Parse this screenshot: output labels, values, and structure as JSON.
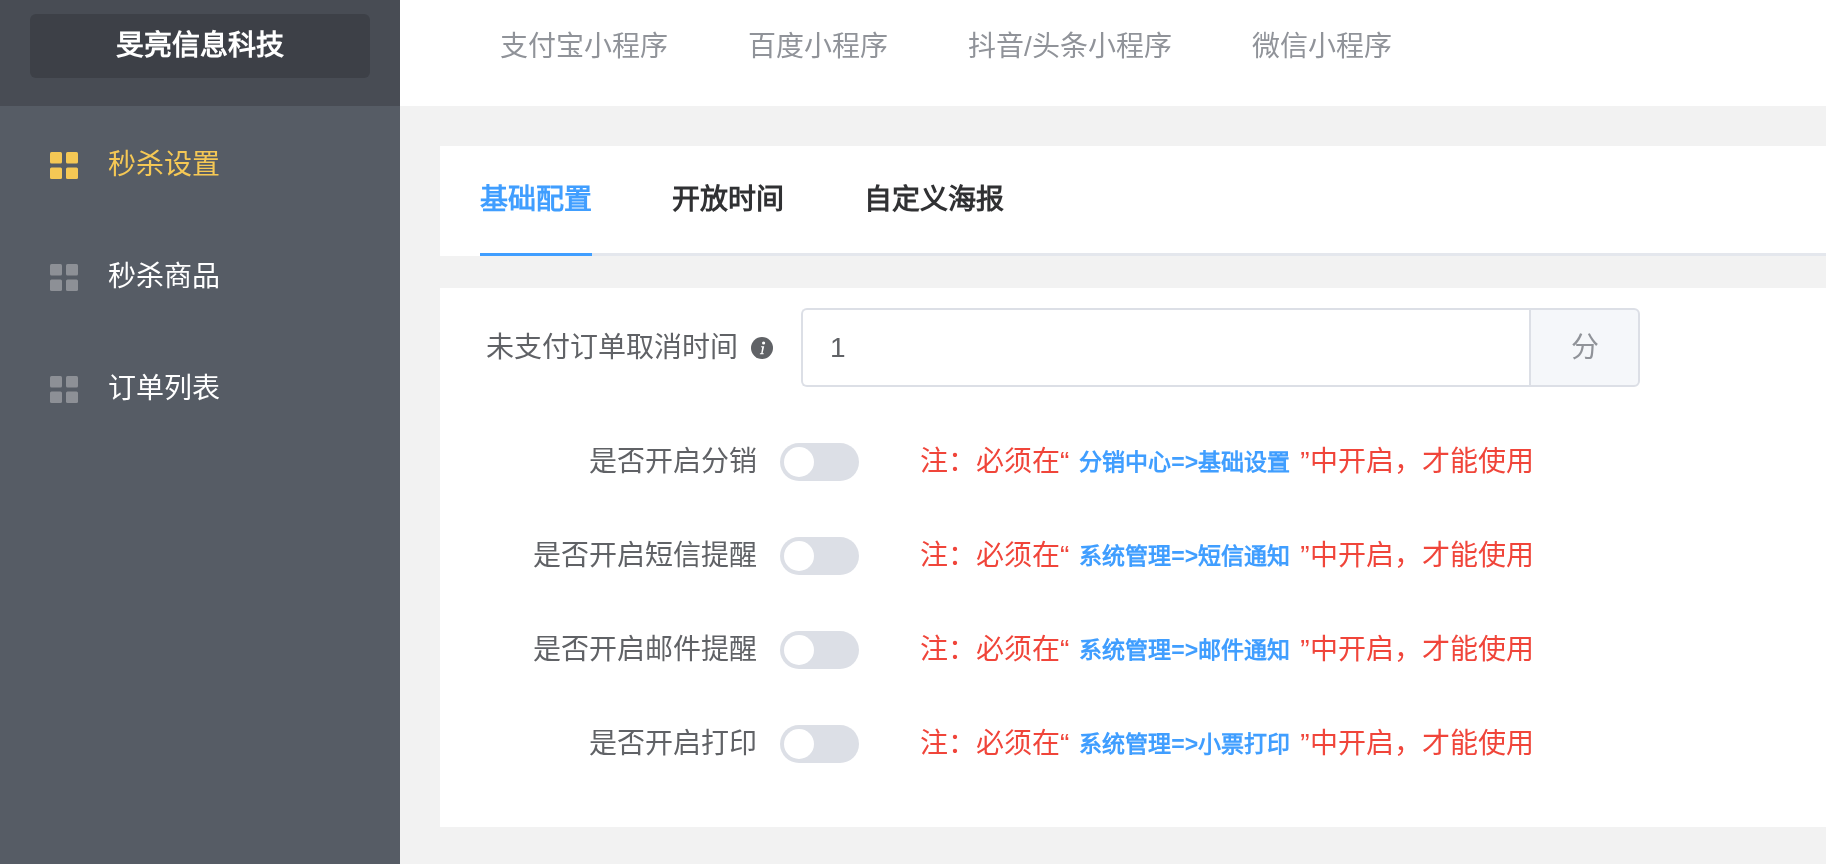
{
  "sidebar": {
    "brand": "旻亮信息科技",
    "items": [
      {
        "label": "秒杀设置",
        "selected": true
      },
      {
        "label": "秒杀商品",
        "selected": false
      },
      {
        "label": "订单列表",
        "selected": false
      }
    ]
  },
  "top_tabs": [
    {
      "label": "支付宝小程序"
    },
    {
      "label": "百度小程序"
    },
    {
      "label": "抖音/头条小程序"
    },
    {
      "label": "微信小程序"
    }
  ],
  "section_tabs": [
    {
      "label": "基础配置",
      "selected": true
    },
    {
      "label": "开放时间",
      "selected": false
    },
    {
      "label": "自定义海报",
      "selected": false
    }
  ],
  "form": {
    "cancel_time": {
      "label": "未支付订单取消时间",
      "value": "1",
      "unit": "分"
    },
    "switches": [
      {
        "label": "是否开启分销",
        "on": false,
        "note": {
          "before": "注：必须在“",
          "link": "分销中心=>基础设置",
          "after": "”中开启，才能使用"
        }
      },
      {
        "label": "是否开启短信提醒",
        "on": false,
        "note": {
          "before": "注：必须在“",
          "link": "系统管理=>短信通知",
          "after": "”中开启，才能使用"
        }
      },
      {
        "label": "是否开启邮件提醒",
        "on": false,
        "note": {
          "before": "注：必须在“",
          "link": "系统管理=>邮件通知",
          "after": "”中开启，才能使用"
        }
      },
      {
        "label": "是否开启打印",
        "on": false,
        "note": {
          "before": "注：必须在“",
          "link": "系统管理=>小票打印",
          "after": "”中开启，才能使用"
        }
      }
    ]
  }
}
